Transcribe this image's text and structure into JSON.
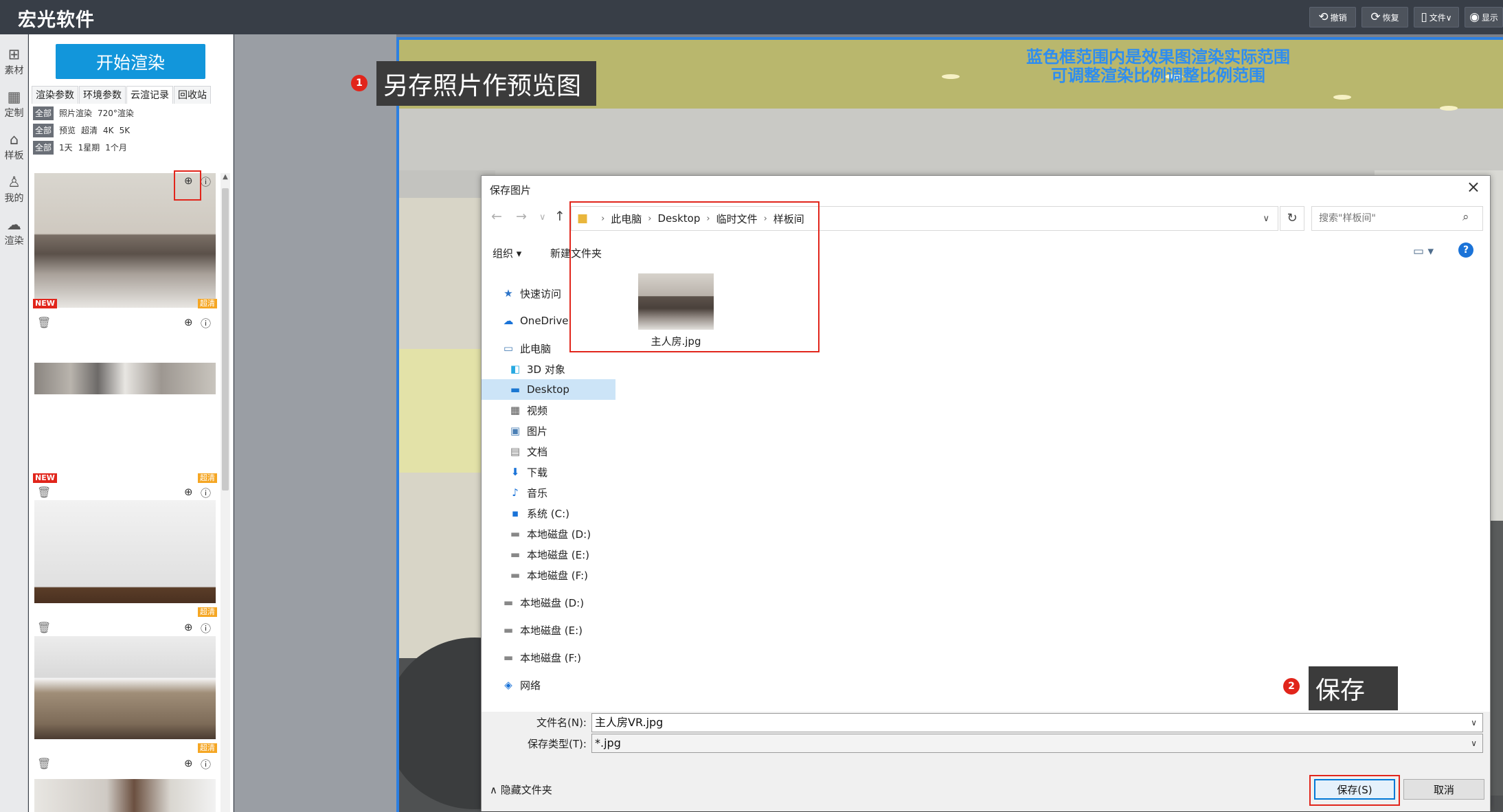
{
  "app": {
    "brand": "宏光软件",
    "toolbar": [
      {
        "icon": "undo-icon",
        "glyph": "⟲",
        "label": "撤销"
      },
      {
        "icon": "redo-icon",
        "glyph": "⟳",
        "label": "恢复"
      },
      {
        "icon": "file-icon",
        "glyph": "🗋",
        "label": "文件∨"
      },
      {
        "icon": "eye-icon",
        "glyph": "◉",
        "label": "显示"
      }
    ]
  },
  "rail": [
    {
      "icon": "grid-icon",
      "glyph": "⊞",
      "label": "素材"
    },
    {
      "icon": "custom-icon",
      "glyph": "⊞",
      "label": "定制"
    },
    {
      "icon": "home-icon",
      "glyph": "⌂",
      "label": "样板"
    },
    {
      "icon": "user-icon",
      "glyph": "♙",
      "label": "我的"
    },
    {
      "icon": "cloud-icon",
      "glyph": "☁",
      "label": "渲染"
    }
  ],
  "panel": {
    "start_label": "开始渲染",
    "tabs": [
      "渲染参数",
      "环境参数",
      "云渲记录",
      "回收站"
    ],
    "filters": [
      {
        "all": "全部",
        "opts": [
          "照片渲染",
          "720°渲染"
        ]
      },
      {
        "all": "全部",
        "opts": [
          "预览",
          "超清",
          "4K",
          "5K"
        ]
      },
      {
        "all": "全部",
        "opts": [
          "1天",
          "1星期",
          "1个月"
        ]
      }
    ],
    "badge_new": "NEW",
    "badge_hd": "超清"
  },
  "scene": {
    "tip_line1": "蓝色框范围内是效果图渲染实际范围",
    "tip_line2": "可调整渲染比例调整比例范围"
  },
  "callouts": {
    "c1_num": "1",
    "c1_text": "另存照片作预览图",
    "c2_num": "2",
    "c2_text": "保存"
  },
  "dialog": {
    "title": "保存图片",
    "breadcrumb": [
      "此电脑",
      "Desktop",
      "临时文件",
      "样板间"
    ],
    "search_placeholder": "搜索\"样板间\"",
    "organize": "组织 ▾",
    "new_folder": "新建文件夹",
    "tree": [
      {
        "icon": "star-icon",
        "glyph": "★",
        "label": "快速访问",
        "indent": 0,
        "color": "#2b73c8"
      },
      {
        "icon": "onedrive-icon",
        "glyph": "☁",
        "label": "OneDrive",
        "indent": 0,
        "color": "#1a73d8"
      },
      {
        "icon": "pc-icon",
        "glyph": "▭",
        "label": "此电脑",
        "indent": 0,
        "color": "#4a7fb5"
      },
      {
        "icon": "cube-icon",
        "glyph": "◧",
        "label": "3D 对象",
        "indent": 1,
        "color": "#27a9e1"
      },
      {
        "icon": "desktop-icon",
        "glyph": "▬",
        "label": "Desktop",
        "indent": 1,
        "color": "#1b77d2"
      },
      {
        "icon": "video-icon",
        "glyph": "▦",
        "label": "视频",
        "indent": 1,
        "color": "#555"
      },
      {
        "icon": "picture-icon",
        "glyph": "▣",
        "label": "图片",
        "indent": 1,
        "color": "#4a7fb5"
      },
      {
        "icon": "document-icon",
        "glyph": "▤",
        "label": "文档",
        "indent": 1,
        "color": "#777"
      },
      {
        "icon": "download-icon",
        "glyph": "⬇",
        "label": "下载",
        "indent": 1,
        "color": "#1a73d8"
      },
      {
        "icon": "music-icon",
        "glyph": "♪",
        "label": "音乐",
        "indent": 1,
        "color": "#1a73d8"
      },
      {
        "icon": "windows-drive-icon",
        "glyph": "▪",
        "label": "系统 (C:)",
        "indent": 1,
        "color": "#1a73d8"
      },
      {
        "icon": "drive-icon",
        "glyph": "▬",
        "label": "本地磁盘 (D:)",
        "indent": 1,
        "color": "#888"
      },
      {
        "icon": "drive-icon",
        "glyph": "▬",
        "label": "本地磁盘 (E:)",
        "indent": 1,
        "color": "#888"
      },
      {
        "icon": "drive-icon",
        "glyph": "▬",
        "label": "本地磁盘 (F:)",
        "indent": 1,
        "color": "#888"
      },
      {
        "icon": "drive-icon",
        "glyph": "▬",
        "label": "本地磁盘 (D:)",
        "indent": 0,
        "color": "#888"
      },
      {
        "icon": "drive-icon",
        "glyph": "▬",
        "label": "本地磁盘 (E:)",
        "indent": 0,
        "color": "#888"
      },
      {
        "icon": "drive-icon",
        "glyph": "▬",
        "label": "本地磁盘 (F:)",
        "indent": 0,
        "color": "#888"
      },
      {
        "icon": "network-icon",
        "glyph": "◈",
        "label": "网络",
        "indent": 0,
        "color": "#1a73d8"
      }
    ],
    "file": "主人房.jpg",
    "filename_label": "文件名(N):",
    "filename_value": "主人房VR.jpg",
    "filetype_label": "保存类型(T):",
    "filetype_value": "*.jpg",
    "hide_folders": "隐藏文件夹",
    "save_label": "保存(S)",
    "cancel_label": "取消"
  }
}
